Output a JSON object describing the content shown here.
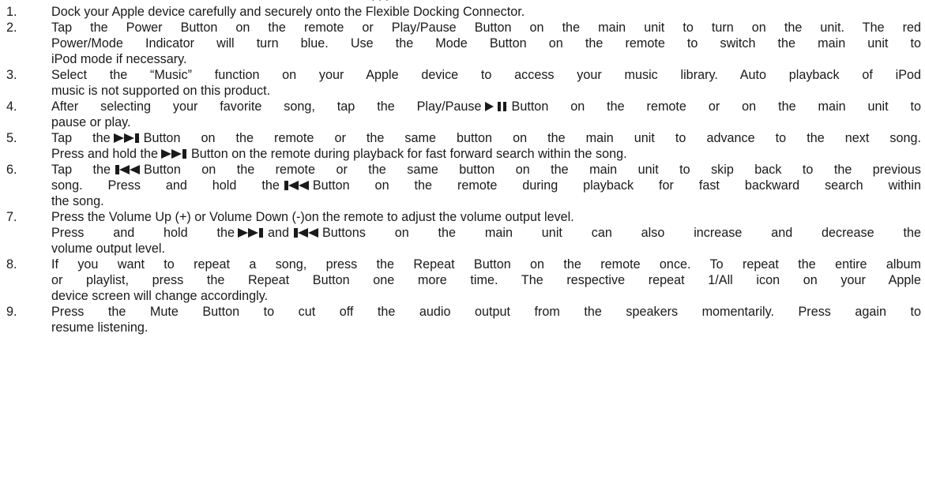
{
  "header_fragment": ", , ,",
  "steps": [
    {
      "num": "1.",
      "lines": [
        "Dock your Apple device carefully and securely onto the Flexible Docking Connector."
      ]
    },
    {
      "num": "2.",
      "lines": [
        "Tap the Power Button on the remote or Play/Pause Button on the main unit to turn on the unit.   The red",
        "Power/Mode Indicator will turn blue.   Use the Mode Button on the remote to switch the main unit to",
        "iPod mode if necessary."
      ]
    },
    {
      "num": "3.",
      "lines": [
        "Select the “Music” function on your Apple device to access your music library.   Auto playback of iPod",
        "music is not supported on this product."
      ]
    },
    {
      "num": "4.",
      "line1_a": "After selecting your favorite song, tap the Play/Pause",
      "line1_b": "Button on the remote or on the main unit to",
      "line2": "pause or play."
    },
    {
      "num": "5.",
      "line1_a": "Tap the",
      "line1_b": "Button on the remote or the same button on the main unit to advance to the next song.",
      "line2_a": "Press and hold the",
      "line2_b": "Button on the remote during playback for fast forward search within the song."
    },
    {
      "num": "6.",
      "line1_a": "Tap the",
      "line1_b": "Button on the remote or the same button on the main unit to skip back to the previous",
      "line2_a": "song.   Press and hold the",
      "line2_b": "Button on the remote during playback for fast backward search within",
      "line3": "the song."
    },
    {
      "num": "7.",
      "line1": "Press the Volume Up (+) or Volume Down (-)on the remote to adjust the volume output level.",
      "line2_a": "Press and hold the",
      "line2_b": "and",
      "line2_c": "Buttons on the main unit can also increase and decrease the",
      "line3": "volume output level."
    },
    {
      "num": "8.",
      "lines": [
        "If you want to repeat a song, press the Repeat Button on the remote once.   To repeat the entire album",
        "or playlist, press the Repeat Button one more time.   The respective repeat 1/All icon on your Apple",
        "device screen will change accordingly."
      ]
    },
    {
      "num": "9.",
      "lines": [
        "Press the Mute Button to cut off the audio output from the speakers momentarily.   Press again to",
        "resume listening."
      ]
    }
  ],
  "icons": {
    "play_pause": "play-pause-icon",
    "next": "next-track-icon",
    "previous": "previous-track-icon"
  }
}
